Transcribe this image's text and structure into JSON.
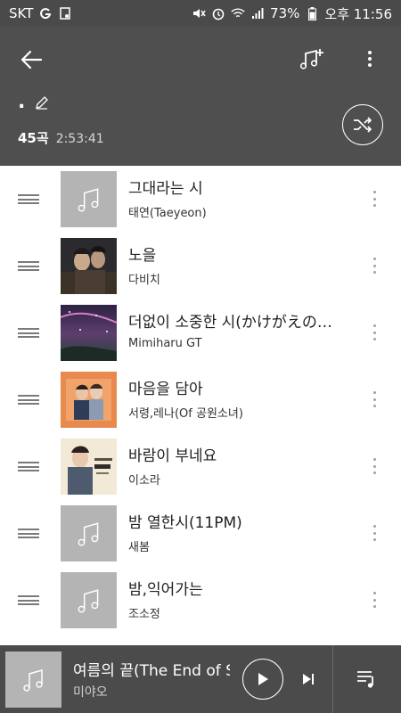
{
  "status_bar": {
    "carrier": "SKT",
    "battery": "73%",
    "time": "오후 11:56"
  },
  "playlist": {
    "title": ".",
    "count": "45곡",
    "duration": "2:53:41"
  },
  "songs": [
    {
      "title": "그대라는 시",
      "artist": "태연(Taeyeon)",
      "art": "placeholder"
    },
    {
      "title": "노을",
      "artist": "다비치",
      "art": "cover-dark-couple"
    },
    {
      "title": "더없이 소중한 시(かけがえの…",
      "artist": "Mimiharu GT",
      "art": "cover-starry-sky"
    },
    {
      "title": "마음을 담아",
      "artist": "서령,레나(Of 공원소녀)",
      "art": "cover-orange-couple"
    },
    {
      "title": "바람이 부네요",
      "artist": "이소라",
      "art": "cover-portrait-cream"
    },
    {
      "title": "밤 열한시(11PM)",
      "artist": "새봄",
      "art": "placeholder"
    },
    {
      "title": "밤,익어가는",
      "artist": "조소정",
      "art": "placeholder"
    }
  ],
  "now_playing": {
    "title": "여름의 끝(The End of S",
    "artist": "미야오"
  },
  "colors": {
    "header_bg": "#4f4f4f",
    "player_bg": "#4b4b4b",
    "placeholder_bg": "#b4b4b4"
  }
}
